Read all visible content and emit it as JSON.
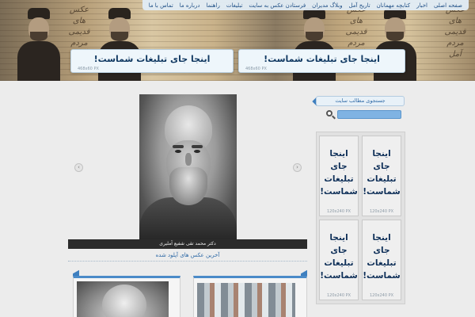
{
  "nav": {
    "items": [
      "صفحه اصلی",
      "اخبار",
      "کتابچه مهمانان",
      "تاریخ آمل",
      "وبلاگ مدیران",
      "فرستادن عکس به سایت",
      "تبلیغات",
      "راهنما",
      "درباره ما",
      "تماس با ما"
    ]
  },
  "header": {
    "calligraphy": "عکس های قدیمی مردم آمل"
  },
  "banners": [
    {
      "text": "اینجا جای تبلیغات شماست!",
      "size": "468x60  PX"
    },
    {
      "text": "اینجا جای تبلیغات شماست!",
      "size": "468x60  PX"
    }
  ],
  "slider": {
    "caption": "دکتر محمد تقی شفیع آملیری",
    "prev": "‹",
    "next": "›"
  },
  "recent": {
    "title": "آخرین عکس های آپلود شده"
  },
  "search": {
    "title": "جستجوی مطالب سایت",
    "placeholder": ""
  },
  "ads": [
    {
      "text": "اینجا جای تبلیغات شماست!",
      "size": "120x240  PX"
    },
    {
      "text": "اینجا جای تبلیغات شماست!",
      "size": "120x240  PX"
    },
    {
      "text": "اینجا جای تبلیغات شماست!",
      "size": "120x240  PX"
    },
    {
      "text": "اینجا جای تبلیغات شماست!",
      "size": "120x240  PX"
    }
  ],
  "colors": {
    "accent": "#3e7fbf",
    "link": "#2f6aa6",
    "ad_text": "#0e2f58"
  }
}
